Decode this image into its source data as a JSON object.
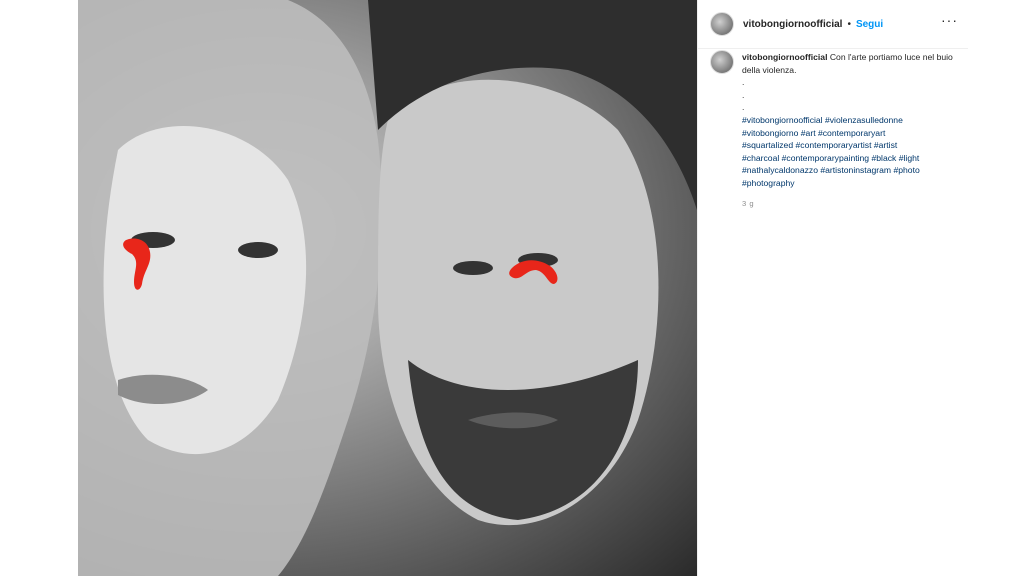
{
  "post": {
    "image_description": "photo",
    "author": "vitobongiornoofficial",
    "follow_label": "Segui",
    "separator": "•",
    "more_glyph": "···"
  },
  "caption": {
    "username": "vitobongiornoofficial",
    "text_line1": "Con l'arte portiamo luce nel buio della violenza.",
    "dots": [
      ".",
      ".",
      "."
    ],
    "hashtags": [
      "#vitobongiornoofficial",
      "#violenzasulledonne",
      "#vitobongiorno",
      "#art",
      "#contemporaryart",
      "#squartalized",
      "#contemporaryartist",
      "#artist",
      "#charcoal",
      "#contemporarypainting",
      "#black",
      "#light",
      "#nathalycaldonazzo",
      "#artistoninstagram",
      "#photo",
      "#photography"
    ],
    "timestamp": "3 g"
  },
  "colors": {
    "link": "#00376b",
    "follow": "#0095f6",
    "tear": "#e8261a"
  }
}
